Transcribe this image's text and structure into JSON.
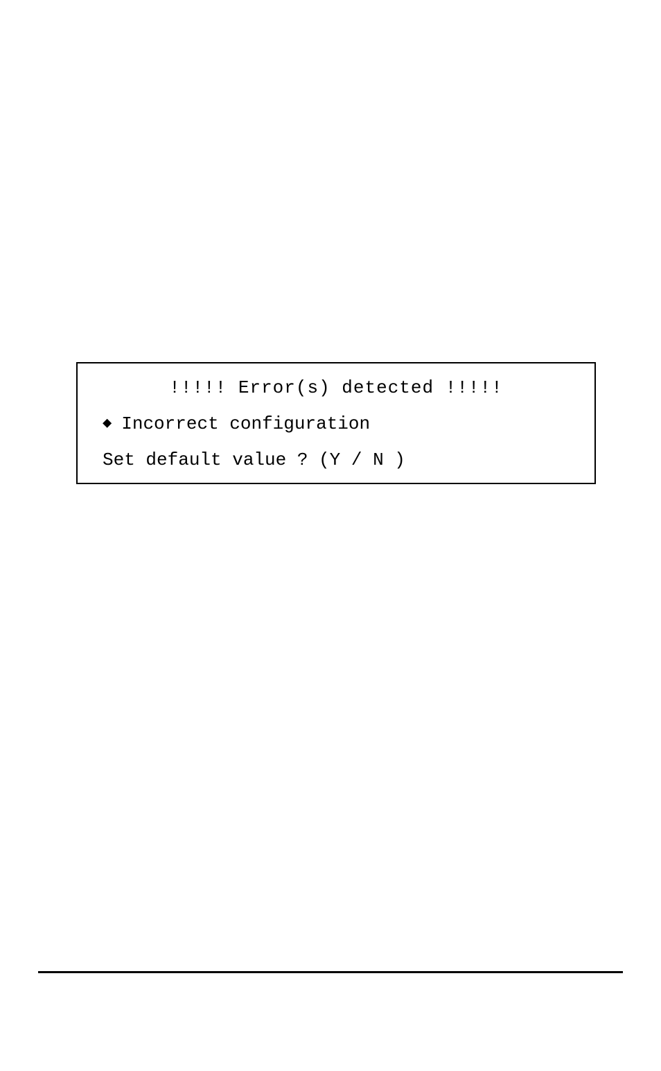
{
  "dialog": {
    "title": "!!!!! Error(s) detected !!!!!",
    "error_message": "Incorrect configuration",
    "prompt": "Set default value ? (Y / N )",
    "bullet_icon": "◆"
  }
}
